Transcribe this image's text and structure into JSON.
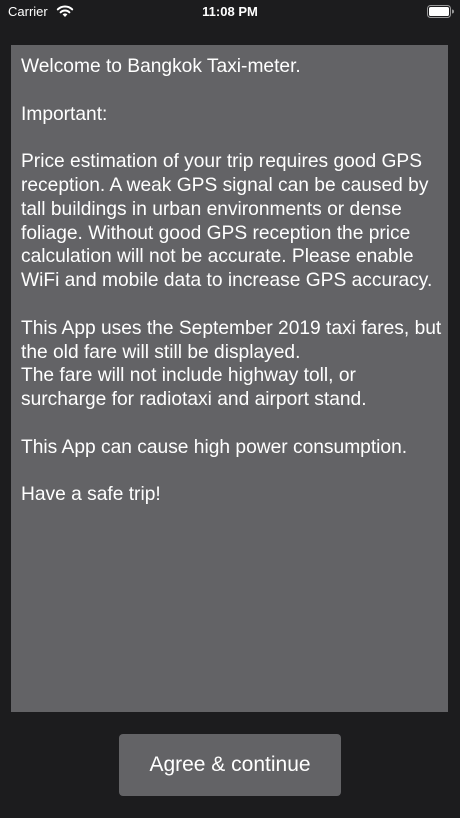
{
  "status_bar": {
    "carrier": "Carrier",
    "time": "11:08 PM"
  },
  "welcome": {
    "text": "Welcome to Bangkok Taxi-meter.\n\nImportant:\n\nPrice estimation of your trip requires good GPS reception. A weak GPS signal can be caused by tall buildings in urban environments or dense foliage. Without good GPS reception the price calculation will not be accurate. Please enable WiFi and mobile data to increase GPS accuracy.\n\nThis App uses the September 2019 taxi fares, but the old fare will still be displayed.\nThe fare will not include highway toll, or surcharge for radiotaxi and airport stand.\n\nThis App can cause high power consumption.\n\nHave a safe trip!"
  },
  "actions": {
    "agree_label": "Agree & continue"
  },
  "colors": {
    "background": "#1c1c1e",
    "panel": "#636366",
    "text": "#ffffff"
  },
  "icons": {
    "wifi": "wifi-icon",
    "battery": "battery-icon"
  }
}
